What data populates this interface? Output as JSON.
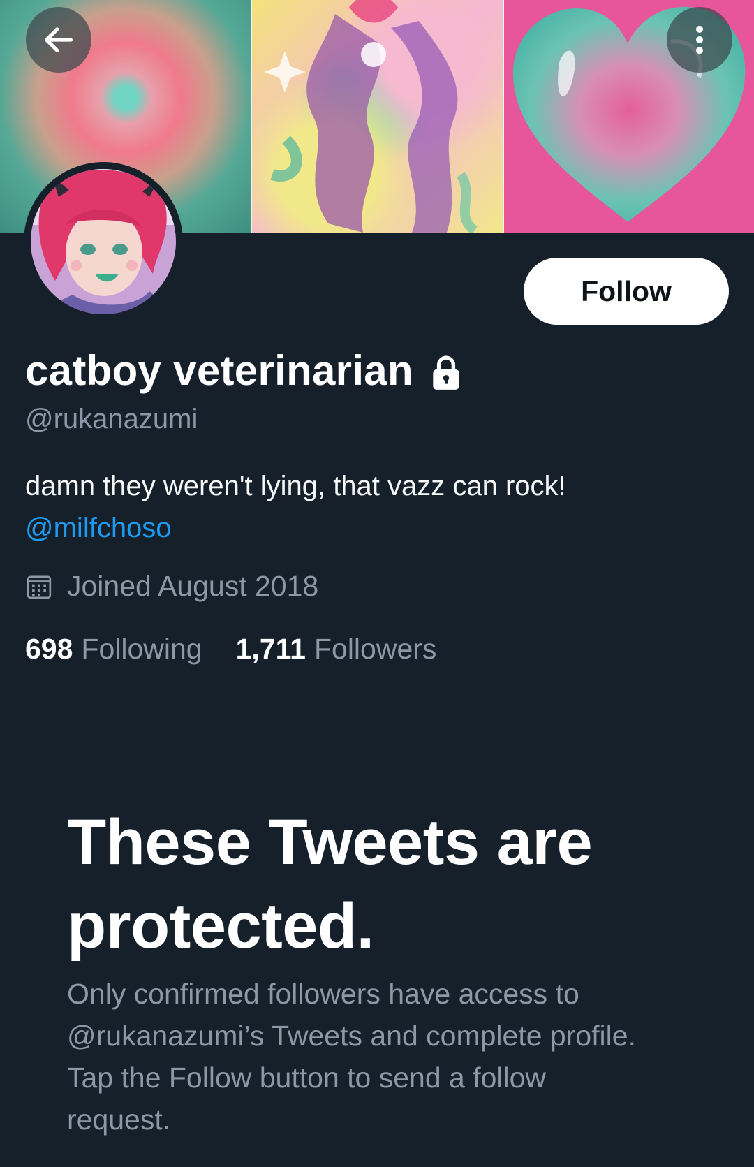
{
  "colors": {
    "background": "#15202b",
    "primary_text": "#ffffff",
    "secondary_text": "#8b98a5",
    "link": "#1d9bf0",
    "follow_button_bg": "#ffffff",
    "follow_button_text": "#0f1419"
  },
  "header": {
    "back_icon": "arrow-left-icon",
    "more_icon": "more-vertical-icon",
    "banner_description": [
      "teal-pink gradient",
      "psychedelic figure",
      "glossy teal heart on pink"
    ]
  },
  "profile": {
    "display_name": "catboy veterinarian",
    "protected_icon": "lock-icon",
    "handle": "@rukanazumi",
    "bio_text": "damn they weren't lying, that vazz can rock!",
    "bio_mention": "@milfchoso",
    "joined_icon": "calendar-icon",
    "joined": "Joined August 2018",
    "following_count": "698",
    "following_label": "Following",
    "followers_count": "1,711",
    "followers_label": "Followers"
  },
  "actions": {
    "follow_label": "Follow"
  },
  "protected_notice": {
    "title": "These Tweets are protected.",
    "description": "Only confirmed followers have access to @rukanazumi’s Tweets and complete profile. Tap the Follow button to send a follow request."
  }
}
